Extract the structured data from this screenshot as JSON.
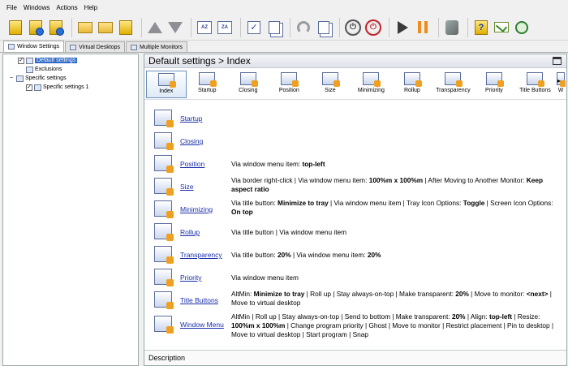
{
  "menu": [
    "File",
    "Windows",
    "Actions",
    "Help"
  ],
  "tabs": [
    {
      "label": "Window Settings",
      "active": true
    },
    {
      "label": "Virtual Desktops",
      "active": false
    },
    {
      "label": "Multiple Monitors",
      "active": false
    }
  ],
  "tree": {
    "default_settings": "Default settings",
    "exclusions": "Exclusions",
    "specific_settings": "Specific settings",
    "specific_settings_1": "Specific settings 1"
  },
  "panel": {
    "title": "Default settings > Index",
    "description_label": "Description"
  },
  "categories": [
    "Index",
    "Startup",
    "Closing",
    "Position",
    "Size",
    "Minimizing",
    "Rollup",
    "Transparency",
    "Priority",
    "Title Buttons",
    "W"
  ],
  "rows": [
    {
      "link": "Startup",
      "desc": []
    },
    {
      "link": "Closing",
      "desc": []
    },
    {
      "link": "Position",
      "desc": [
        [
          "Via window menu item: ",
          false
        ],
        [
          "top-left",
          true
        ]
      ]
    },
    {
      "link": "Size",
      "desc": [
        [
          "Via border right-click | Via window menu item: ",
          false
        ],
        [
          "100%m x 100%m",
          true
        ],
        [
          " | After Moving to Another Monitor: ",
          false
        ],
        [
          "Keep aspect ratio",
          true
        ]
      ]
    },
    {
      "link": "Minimizing",
      "desc": [
        [
          "Via title button: ",
          false
        ],
        [
          "Minimize to tray",
          true
        ],
        [
          " | Via window menu item | Tray Icon Options: ",
          false
        ],
        [
          "Toggle",
          true
        ],
        [
          " | Screen Icon Options: ",
          false
        ],
        [
          "On top",
          true
        ]
      ]
    },
    {
      "link": "Rollup",
      "desc": [
        [
          "Via title button | Via window menu item",
          false
        ]
      ]
    },
    {
      "link": "Transparency",
      "desc": [
        [
          "Via title button: ",
          false
        ],
        [
          "20%",
          true
        ],
        [
          " | Via window menu item: ",
          false
        ],
        [
          "20%",
          true
        ]
      ]
    },
    {
      "link": "Priority",
      "desc": [
        [
          "Via window menu item",
          false
        ]
      ]
    },
    {
      "link": "Title Buttons",
      "desc": [
        [
          "AltMin: ",
          false
        ],
        [
          "Minimize to tray",
          true
        ],
        [
          " | Roll up | Stay always-on-top | Make transparent: ",
          false
        ],
        [
          "20%",
          true
        ],
        [
          " | Move to monitor: ",
          false
        ],
        [
          "<next>",
          true
        ],
        [
          " | Move to virtual desktop",
          false
        ]
      ]
    },
    {
      "link": "Window Menu",
      "desc": [
        [
          "AltMin | Roll up | Stay always-on-top | Send to bottom | Make transparent: ",
          false
        ],
        [
          "20%",
          true
        ],
        [
          " | Align: ",
          false
        ],
        [
          "top-left",
          true
        ],
        [
          " | Resize: ",
          false
        ],
        [
          "100%m x 100%m",
          true
        ],
        [
          " | Change program priority | Ghost | Move to monitor | Restrict placement | Pin to desktop | Move to virtual desktop | Start program | Snap",
          false
        ]
      ]
    }
  ]
}
